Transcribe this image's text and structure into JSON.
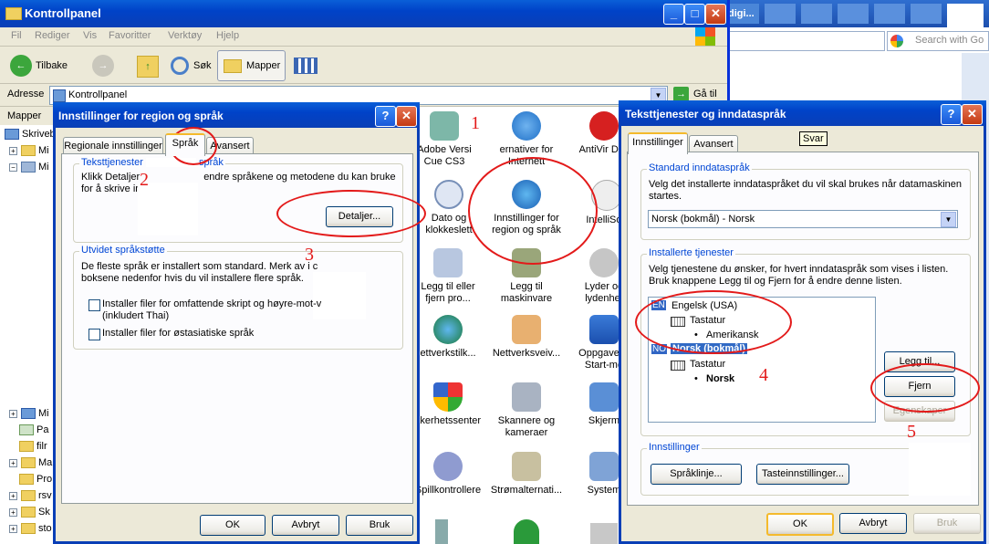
{
  "explorer": {
    "title": "Kontrollpanel",
    "menu": [
      "Fil",
      "Rediger",
      "Vis",
      "Favoritter",
      "Verktøy",
      "Hjelp"
    ],
    "back_label": "Tilbake",
    "search_label": "Søk",
    "folders_label": "Mapper",
    "address_label": "Adresse",
    "address_value": "Kontrollpanel",
    "go_label": "Gå til",
    "folders_pane_label": "Mapper",
    "tree": [
      "Skrivebo",
      "Mi",
      "Mi",
      "Mi",
      "Pa",
      "filr",
      "Ma",
      "Pro",
      "rsv",
      "Sk",
      "sto"
    ]
  },
  "cp_items": [
    {
      "label": "Adobe Versi\nCue CS3",
      "icon": "adobe-version-cue-icon"
    },
    {
      "label": "ernativer for\nInternett",
      "icon": "internet-options-icon"
    },
    {
      "label": "AntiVir Des",
      "icon": "antivir-icon"
    },
    {
      "label": "Dato og\nklokkeslett",
      "icon": "date-time-icon"
    },
    {
      "label": "Innstillinger for\nregion og språk",
      "icon": "region-language-icon"
    },
    {
      "label": "IntelliSon",
      "icon": "intellisonic-icon"
    },
    {
      "label": "Legg til eller\nfjern pro...",
      "icon": "add-remove-programs-icon"
    },
    {
      "label": "Legg til\nmaskinvare",
      "icon": "add-hardware-icon"
    },
    {
      "label": "Lyder og\nlydenhet",
      "icon": "sounds-icon"
    },
    {
      "label": "ettverkstilk...",
      "icon": "network-connections-icon"
    },
    {
      "label": "Nettverksveiv...",
      "icon": "network-wizard-icon"
    },
    {
      "label": "Oppgavelin\nStart-me",
      "icon": "taskbar-start-icon"
    },
    {
      "label": "kkerhetssenter",
      "icon": "security-center-icon"
    },
    {
      "label": "Skannere og\nkameraer",
      "icon": "scanners-cameras-icon"
    },
    {
      "label": "Skjerm",
      "icon": "display-icon"
    },
    {
      "label": "Spillkontrollere",
      "icon": "game-controllers-icon"
    },
    {
      "label": "Strømalternati...",
      "icon": "power-options-icon"
    },
    {
      "label": "System",
      "icon": "system-icon"
    }
  ],
  "browser": {
    "tabs": [
      "digi...",
      "",
      "",
      "",
      "",
      "",
      ""
    ],
    "search_placeholder": "Search with Go"
  },
  "region_dialog": {
    "title": "Innstillinger for region og språk",
    "tabs": [
      "Regionale innstillinger",
      "Språk",
      "Avansert"
    ],
    "text_services_group": "Teksttjenester",
    "text_services_group_tail": "språk",
    "text_services_desc_a": "Klikk Detaljer",
    "text_services_desc_b": "endre språkene og metodene du kan bruke",
    "text_services_desc_c": "for å skrive in",
    "details_button": "Detaljer...",
    "extended_group": "Utvidet språkstøtte",
    "extended_desc_a": "De fleste språk er installert som standard. Merk av i c",
    "extended_desc_b": "boksene nedenfor hvis du vil installere flere språk.",
    "checkbox1": "Installer filer for omfattende skript og høyre-mot-v",
    "checkbox1_b": "(inkludert Thai)",
    "checkbox2": "Installer filer for østasiatiske språk",
    "ok": "OK",
    "cancel": "Avbryt",
    "apply": "Bruk"
  },
  "text_dialog": {
    "title": "Teksttjenester og inndataspråk",
    "tabs": [
      "Innstillinger",
      "Avansert"
    ],
    "tooltip": "Svar",
    "default_group": "Standard inndataspråk",
    "default_desc": "Velg det installerte inndataspråket du vil skal brukes når datamaskinen startes.",
    "default_value": "Norsk (bokmål) - Norsk",
    "installed_group": "Installerte tjenester",
    "installed_desc": "Velg tjenestene du ønsker, for hvert inndataspråk som vises i listen. Bruk knappene Legg til og Fjern for å endre denne listen.",
    "lang1_code": "EN",
    "lang1": "Engelsk (USA)",
    "lang1_kb": "Tastatur",
    "lang1_layout": "Amerikansk",
    "lang2_code": "NO",
    "lang2": "Norsk (bokmål)",
    "lang2_kb": "Tastatur",
    "lang2_layout": "Norsk",
    "add_button": "Legg til...",
    "remove_button": "Fjern",
    "properties_button": "Egenskaper",
    "settings_group": "Innstillinger",
    "language_bar_button": "Språklinje...",
    "key_settings_button": "Tasteinnstillinger...",
    "ok": "OK",
    "cancel": "Avbryt",
    "apply": "Bruk"
  },
  "annotations": [
    "1",
    "2",
    "3",
    "4",
    "5"
  ]
}
